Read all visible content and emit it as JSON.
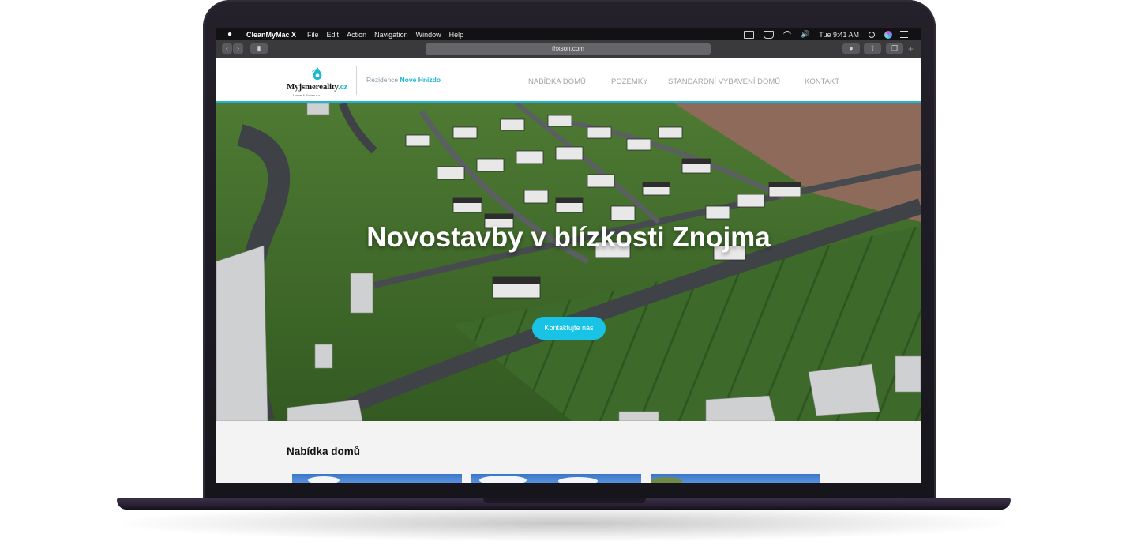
{
  "menubar": {
    "app_name": "CleanMyMac X",
    "menus": [
      "File",
      "Edit",
      "Action",
      "Navigation",
      "Window",
      "Help"
    ],
    "clock": "Tue 9:41 AM",
    "status_icons": [
      "display-icon",
      "airplay-icon",
      "wifi-icon",
      "volume-icon",
      "search-icon",
      "siri-icon",
      "list-icon"
    ]
  },
  "browser": {
    "url": "thxson.com"
  },
  "site": {
    "logo": {
      "part1": "Myjsme",
      "part2": "reality",
      "part3": ".cz",
      "sub": "Lorem & Zuča s.r.o."
    },
    "tagline_prefix": "Rezidence",
    "tagline_name": "Nové Hnízdo",
    "nav": [
      "NABÍDKA DOMŮ",
      "POZEMKY",
      "STANDARDNÍ VYBAVENÍ DOMŮ",
      "KONTAKT"
    ],
    "accent": "#1fb6d4"
  },
  "hero": {
    "title": "Novostavby v blízkosti Znojma",
    "cta": "Kontaktujte nás"
  },
  "offer": {
    "title": "Nabídka domů"
  }
}
